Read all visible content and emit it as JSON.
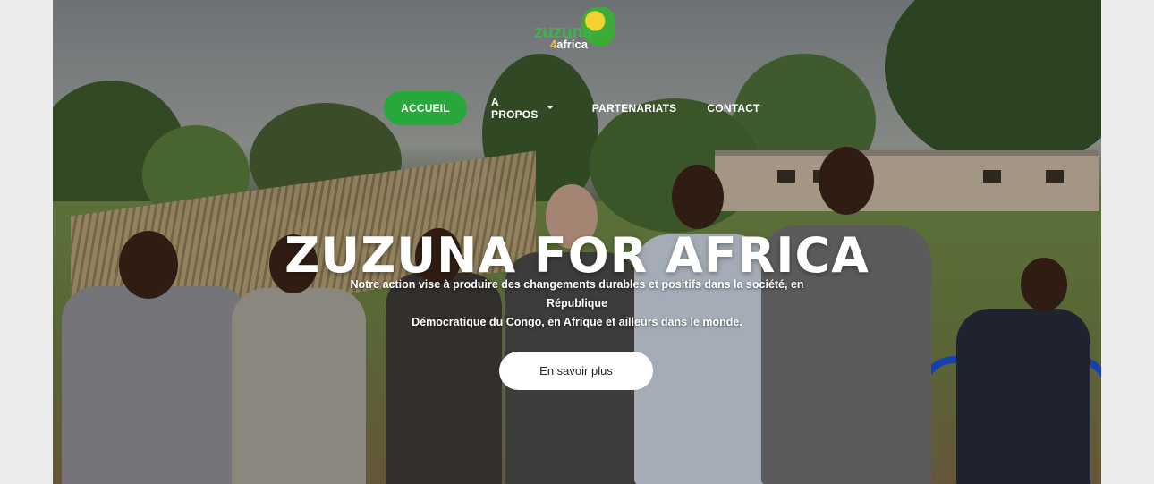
{
  "logo": {
    "main": "zuzuna",
    "four": "4",
    "sub": "africa"
  },
  "nav": {
    "items": [
      {
        "label": "ACCUEIL",
        "active": true
      },
      {
        "label": "A PROPOS",
        "dropdown": true
      },
      {
        "label": "PARTENARIATS"
      },
      {
        "label": "CONTACT"
      }
    ]
  },
  "hero": {
    "title": "ZUZUNA FOR AFRICA",
    "description_line1": "Notre action vise à produire des changements durables et positifs dans la société, en République",
    "description_line2": "Démocratique du Congo, en Afrique et ailleurs dans le monde.",
    "cta_label": "En savoir plus"
  },
  "colors": {
    "accent": "#28a83a",
    "logo_green": "#3fb24a",
    "logo_yellow": "#f2d230",
    "button_bg": "#ffffff"
  }
}
